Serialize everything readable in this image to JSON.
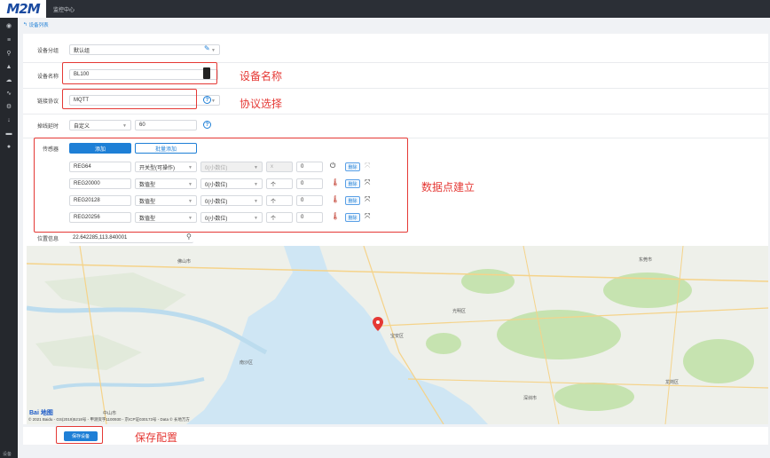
{
  "app": {
    "logo": "M2M",
    "title": "监控中心"
  },
  "breadcrumb": {
    "label": "设备列表"
  },
  "sidebar": {
    "bottom_text": "设备"
  },
  "form": {
    "group": {
      "label": "设备分组",
      "value": "默认组"
    },
    "name": {
      "label": "设备名称",
      "value": "BL100"
    },
    "protocol": {
      "label": "链接协议",
      "value": "MQTT"
    },
    "offline": {
      "label": "掉线延时",
      "mode": "自定义",
      "value": "60"
    },
    "sensor": {
      "label": "传感器",
      "add_button": "添加",
      "batch_add_button": "批量添加",
      "rows": [
        {
          "reg": "REG64",
          "type": "开关型(可操作)",
          "decimal": "0(小数位)",
          "op": "x",
          "value": "0",
          "delete": "删除"
        },
        {
          "reg": "REG20000",
          "type": "数值型",
          "decimal": "0(小数位)",
          "op": "个",
          "value": "0",
          "delete": "删除"
        },
        {
          "reg": "REG20128",
          "type": "数值型",
          "decimal": "0(小数位)",
          "op": "个",
          "value": "0",
          "delete": "删除"
        },
        {
          "reg": "REG20256",
          "type": "数值型",
          "decimal": "0(小数位)",
          "op": "个",
          "value": "0",
          "delete": "删除"
        }
      ]
    },
    "location": {
      "label": "位置信息",
      "value": "22.642285,113.840001"
    },
    "save_button": "保存设备"
  },
  "annotations": {
    "name": "设备名称",
    "protocol": "协议选择",
    "sensors": "数据点建立",
    "save": "保存配置"
  },
  "map": {
    "labels": [
      "佛山市",
      "中山市",
      "东莞市",
      "深圳市",
      "南沙区",
      "宝安区",
      "光明区",
      "龙岗区"
    ],
    "baidu": "Bai 地图",
    "copyright": "© 2021 Baidu - GS(2019)5218号 - 甲测资字1100930 - 京ICP证030173号 - Data © 长地万方"
  },
  "colors": {
    "accent": "#1e7fd6",
    "annotation": "#e53935",
    "sidebar": "#25282d",
    "topbar": "#2b2f36",
    "water": "#cfe6f4",
    "land": "#eef0ea",
    "green": "#c6e3b0"
  }
}
